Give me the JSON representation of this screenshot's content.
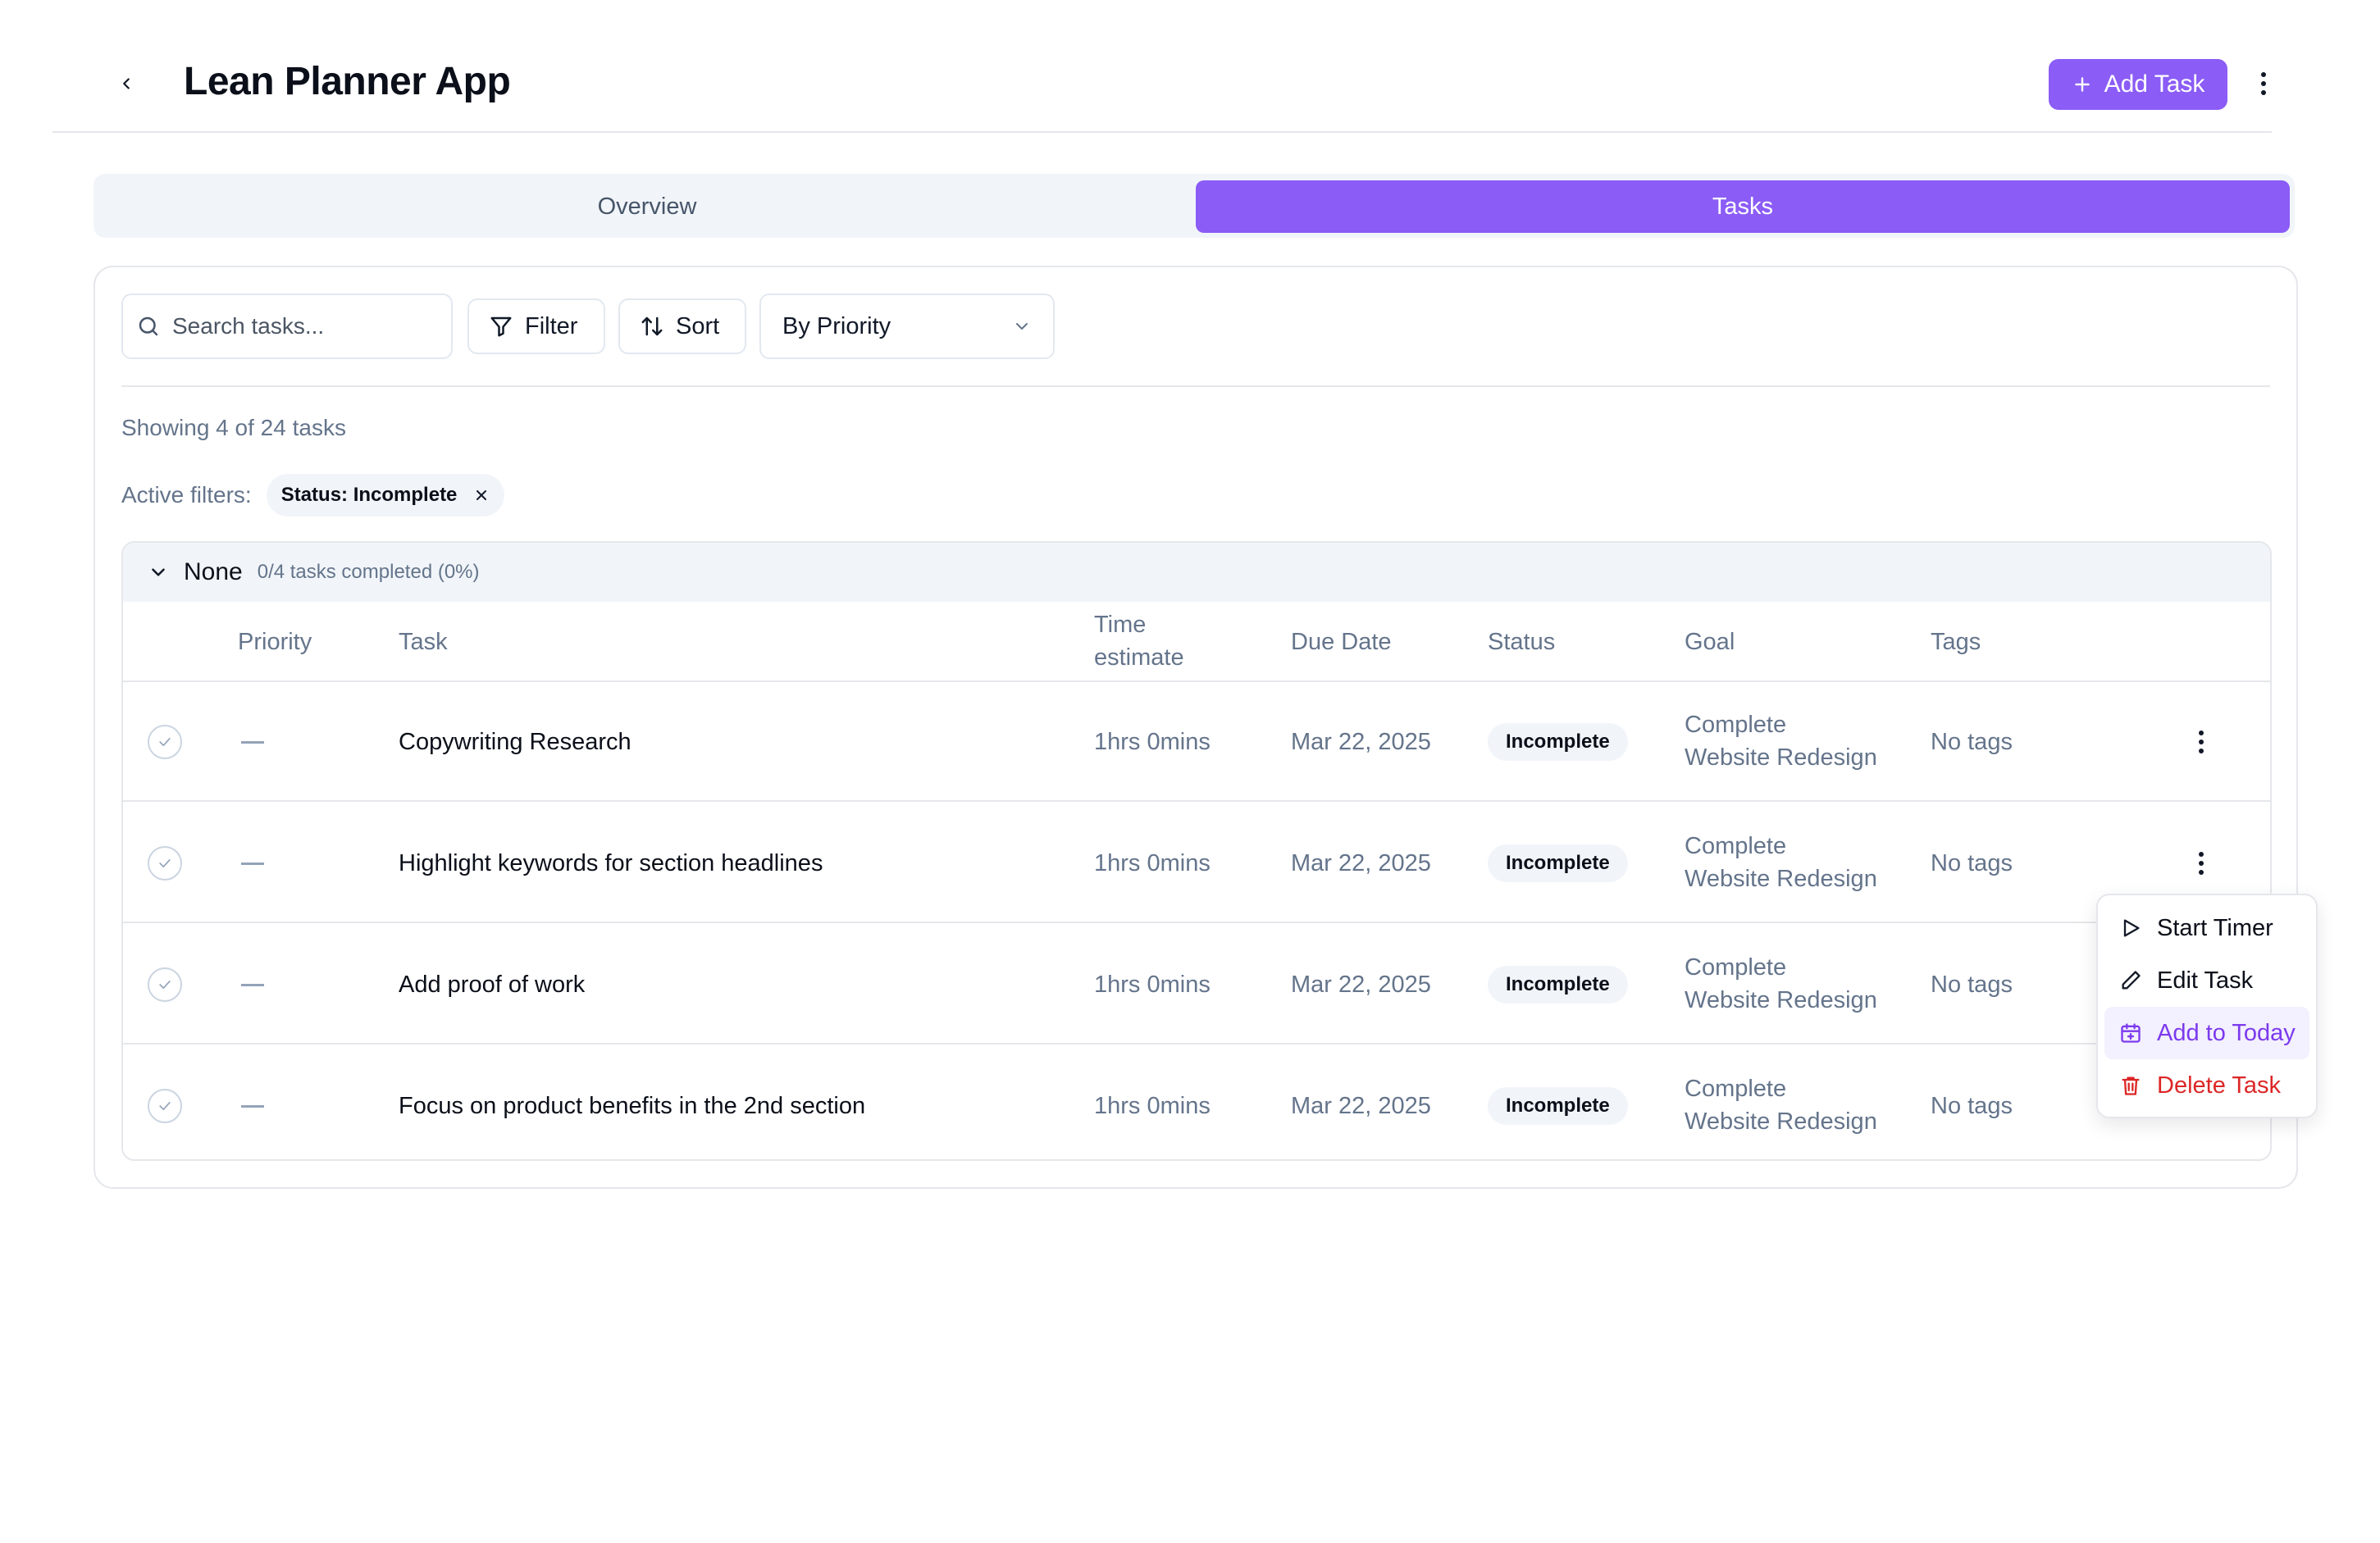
{
  "header": {
    "title": "Lean Planner App",
    "add_task_label": "Add Task"
  },
  "tabs": [
    {
      "label": "Overview",
      "active": false
    },
    {
      "label": "Tasks",
      "active": true
    }
  ],
  "toolbar": {
    "search_placeholder": "Search tasks...",
    "filter_label": "Filter",
    "sort_label": "Sort",
    "group_by_value": "By Priority"
  },
  "summary": {
    "showing": "Showing 4 of 24 tasks",
    "active_filters_label": "Active filters:",
    "filters": [
      "Status: Incomplete"
    ]
  },
  "group": {
    "name": "None",
    "progress": "0/4 tasks completed (0%)"
  },
  "columns": {
    "priority": "Priority",
    "task": "Task",
    "time_line1": "Time",
    "time_line2": "estimate",
    "due": "Due Date",
    "status": "Status",
    "goal": "Goal",
    "tags": "Tags"
  },
  "rows": [
    {
      "task": "Copywriting Research",
      "time": "1hrs 0mins",
      "due": "Mar 22, 2025",
      "status": "Incomplete",
      "goal_line1": "Complete",
      "goal_line2": "Website Redesign",
      "tags": "No tags"
    },
    {
      "task": "Highlight keywords for section headlines",
      "time": "1hrs 0mins",
      "due": "Mar 22, 2025",
      "status": "Incomplete",
      "goal_line1": "Complete",
      "goal_line2": "Website Redesign",
      "tags": "No tags"
    },
    {
      "task": "Add proof of work",
      "time": "1hrs 0mins",
      "due": "Mar 22, 2025",
      "status": "Incomplete",
      "goal_line1": "Complete",
      "goal_line2": "Website Redesign",
      "tags": "No tags"
    },
    {
      "task": "Focus on product benefits in the 2nd section",
      "time": "1hrs 0mins",
      "due": "Mar 22, 2025",
      "status": "Incomplete",
      "goal_line1": "Complete",
      "goal_line2": "Website Redesign",
      "tags": "No tags"
    }
  ],
  "menu": {
    "items": [
      {
        "label": "Start Timer",
        "icon": "play-icon"
      },
      {
        "label": "Edit Task",
        "icon": "pencil-icon"
      },
      {
        "label": "Add to Today",
        "icon": "calendar-plus-icon"
      },
      {
        "label": "Delete Task",
        "icon": "trash-icon"
      }
    ]
  },
  "colors": {
    "accent": "#8b5cf6",
    "danger": "#dc2626",
    "muted_text": "#64748b"
  }
}
